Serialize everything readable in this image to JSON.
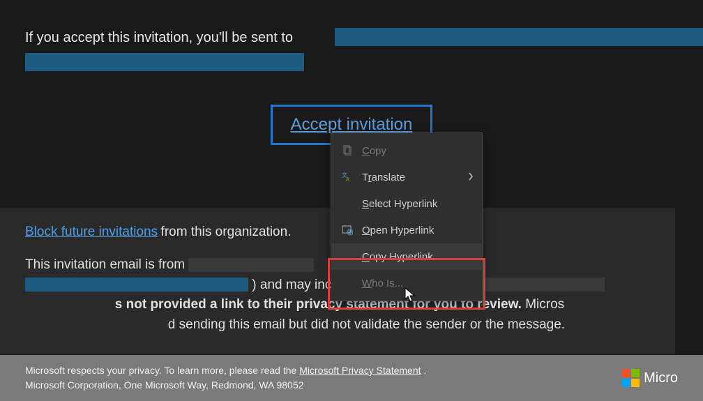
{
  "intro": {
    "text_prefix": "If you accept this invitation, you'll be sent to"
  },
  "accept_button": {
    "label": "Accept invitation"
  },
  "block_section": {
    "link_label": "Block future invitations",
    "suffix": " from this organization."
  },
  "disclaimer": {
    "prefix": "This invitation email is from ",
    "mid1": ") and may include advertising content. ",
    "bold_part": "s not provided a link to their privacy statement for you to review.",
    "tail": " Micros",
    "tail2": "d sending this email but did not validate the sender or the message."
  },
  "footer": {
    "line1_prefix": "Microsoft respects your privacy. To learn more, please read the ",
    "privacy_link": "Microsoft Privacy Statement",
    "line1_suffix": ".",
    "line2": "Microsoft Corporation, One Microsoft Way, Redmond, WA 98052",
    "brand": "Micro"
  },
  "context_menu": {
    "items": {
      "copy": "Copy",
      "translate": "Translate",
      "select_hyperlink": "Select Hyperlink",
      "open_hyperlink": "Open Hyperlink",
      "copy_hyperlink": "Copy Hyperlink",
      "who_is": "Who Is..."
    }
  }
}
